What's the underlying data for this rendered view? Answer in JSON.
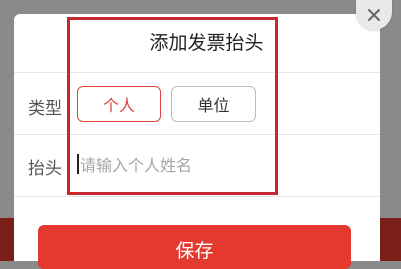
{
  "dialog": {
    "title": "添加发票抬头",
    "close_icon": "close-icon",
    "type_row": {
      "label": "类型",
      "options": [
        "个人",
        "单位"
      ],
      "selected": "个人"
    },
    "header_row": {
      "label": "抬头",
      "value": "",
      "placeholder": "请输入个人姓名"
    },
    "save_label": "保存"
  },
  "colors": {
    "accent": "#e3392e",
    "highlight_box": "#c8282d"
  }
}
